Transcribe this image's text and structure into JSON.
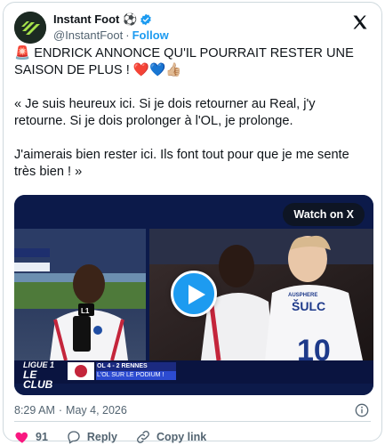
{
  "tweet": {
    "display_name": "Instant Foot ⚽",
    "handle": "@InstantFoot",
    "separator": "·",
    "follow_label": "Follow",
    "text": {
      "line1": "🚨 ENDRICK ANNONCE QU'IL POURRAIT RESTER UNE SAISON DE PLUS ! ❤️💙👍🏼",
      "line2": "« Je suis heureux ici. Si je dois retourner au Real, j'y retourne. Si je dois prolonger à l'OL, je prolonge.",
      "line3": "J'aimerais bien rester ici. Ils font tout pour que je me sente très bien ! »"
    },
    "media": {
      "watch_label": "Watch on X",
      "ligue_line1": "LIGUE 1",
      "ligue_line2": "LE CLUB",
      "score_text": "OL 4 - 2 RENNES",
      "sub_text": "L'OL SUR LE PODIUM !",
      "jersey_name": "ŠULC",
      "sponsor": "AUSPHERE",
      "mic_text": "L1"
    },
    "time": "8:29 AM",
    "date": "May 4, 2026",
    "time_separator": "·",
    "likes": "91",
    "reply_label": "Reply",
    "copy_label": "Copy link"
  },
  "colors": {
    "accent": "#1d9bf0",
    "like_red": "#f91880",
    "text_secondary": "#536471",
    "border": "#cfd9de"
  },
  "icons": [
    "avatar-logo",
    "verified-badge-icon",
    "x-logo-icon",
    "play-icon",
    "info-icon",
    "heart-icon",
    "reply-icon",
    "link-icon"
  ]
}
